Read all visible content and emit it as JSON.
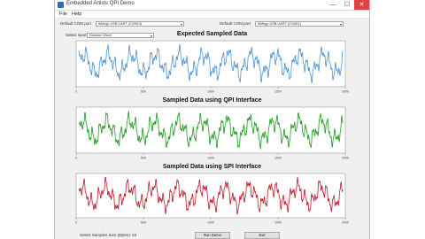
{
  "window": {
    "title": "Embedded Artists QPI Demo",
    "controls": {
      "minimize": "—",
      "maximize": "☐",
      "close": "✕"
    }
  },
  "menu": {
    "file": "File",
    "help": "Help"
  },
  "toolbar": {
    "com_left_label": "Default COM port",
    "com_left_value": "lbMegp USB UART (COM15)",
    "com_right_label": "Default COM port",
    "com_right_value": "lbMegp USB UART (COM11)",
    "wave_label": "Select input",
    "wave_value": "Random Wave"
  },
  "panels": [
    {
      "title": "Expected Sampled Data",
      "color": "#4f92d6",
      "seed": 1
    },
    {
      "title": "Sampled Data using QPI Interface",
      "color": "#1f9a1f",
      "seed": 2
    },
    {
      "title": "Sampled Data using SPI Interface",
      "color": "#c0182a",
      "seed": 3
    }
  ],
  "axis_ticks": [
    "0",
    "500",
    "1000",
    "1500",
    "2000"
  ],
  "status": {
    "samples_text": "Select Samples Size (Bytes): 64"
  },
  "buttons": {
    "run_demo": "Run Demo",
    "exit": "Exit"
  }
}
